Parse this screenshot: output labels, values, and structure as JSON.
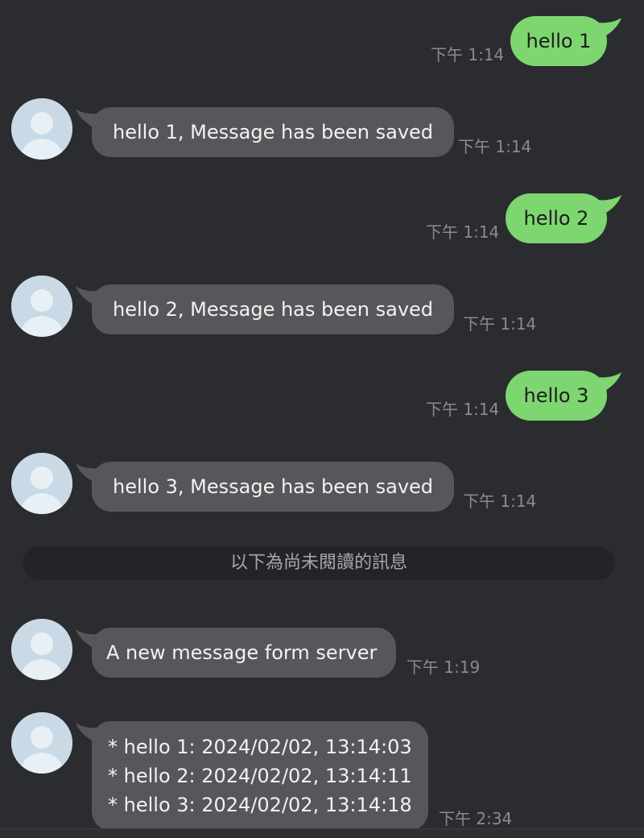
{
  "messages": [
    {
      "type": "sent",
      "text": "hello 1",
      "time": "下午 1:14"
    },
    {
      "type": "received",
      "text": "hello 1, Message has been saved",
      "time": "下午 1:14"
    },
    {
      "type": "sent",
      "text": "hello 2",
      "time": "下午 1:14"
    },
    {
      "type": "received",
      "text": "hello 2, Message has been saved",
      "time": "下午 1:14"
    },
    {
      "type": "sent",
      "text": "hello 3",
      "time": "下午 1:14"
    },
    {
      "type": "received",
      "text": "hello 3, Message has been saved",
      "time": "下午 1:14"
    },
    {
      "type": "received",
      "text": "A new message form server",
      "time": "下午 1:19"
    },
    {
      "type": "received",
      "lines": [
        "* hello 1: 2024/02/02, 13:14:03",
        "* hello 2: 2024/02/02, 13:14:11",
        "* hello 3: 2024/02/02, 13:14:18"
      ],
      "time": "下午 2:34"
    }
  ],
  "unread_divider": "以下為尚未閱讀的訊息",
  "colors": {
    "background": "#2b2c30",
    "sent_bubble": "#7ed670",
    "received_bubble": "#56575a",
    "avatar_bg": "#c9dae6",
    "avatar_fg": "#e9f0f5"
  },
  "icons": {
    "avatar": "default-user-avatar-icon"
  }
}
